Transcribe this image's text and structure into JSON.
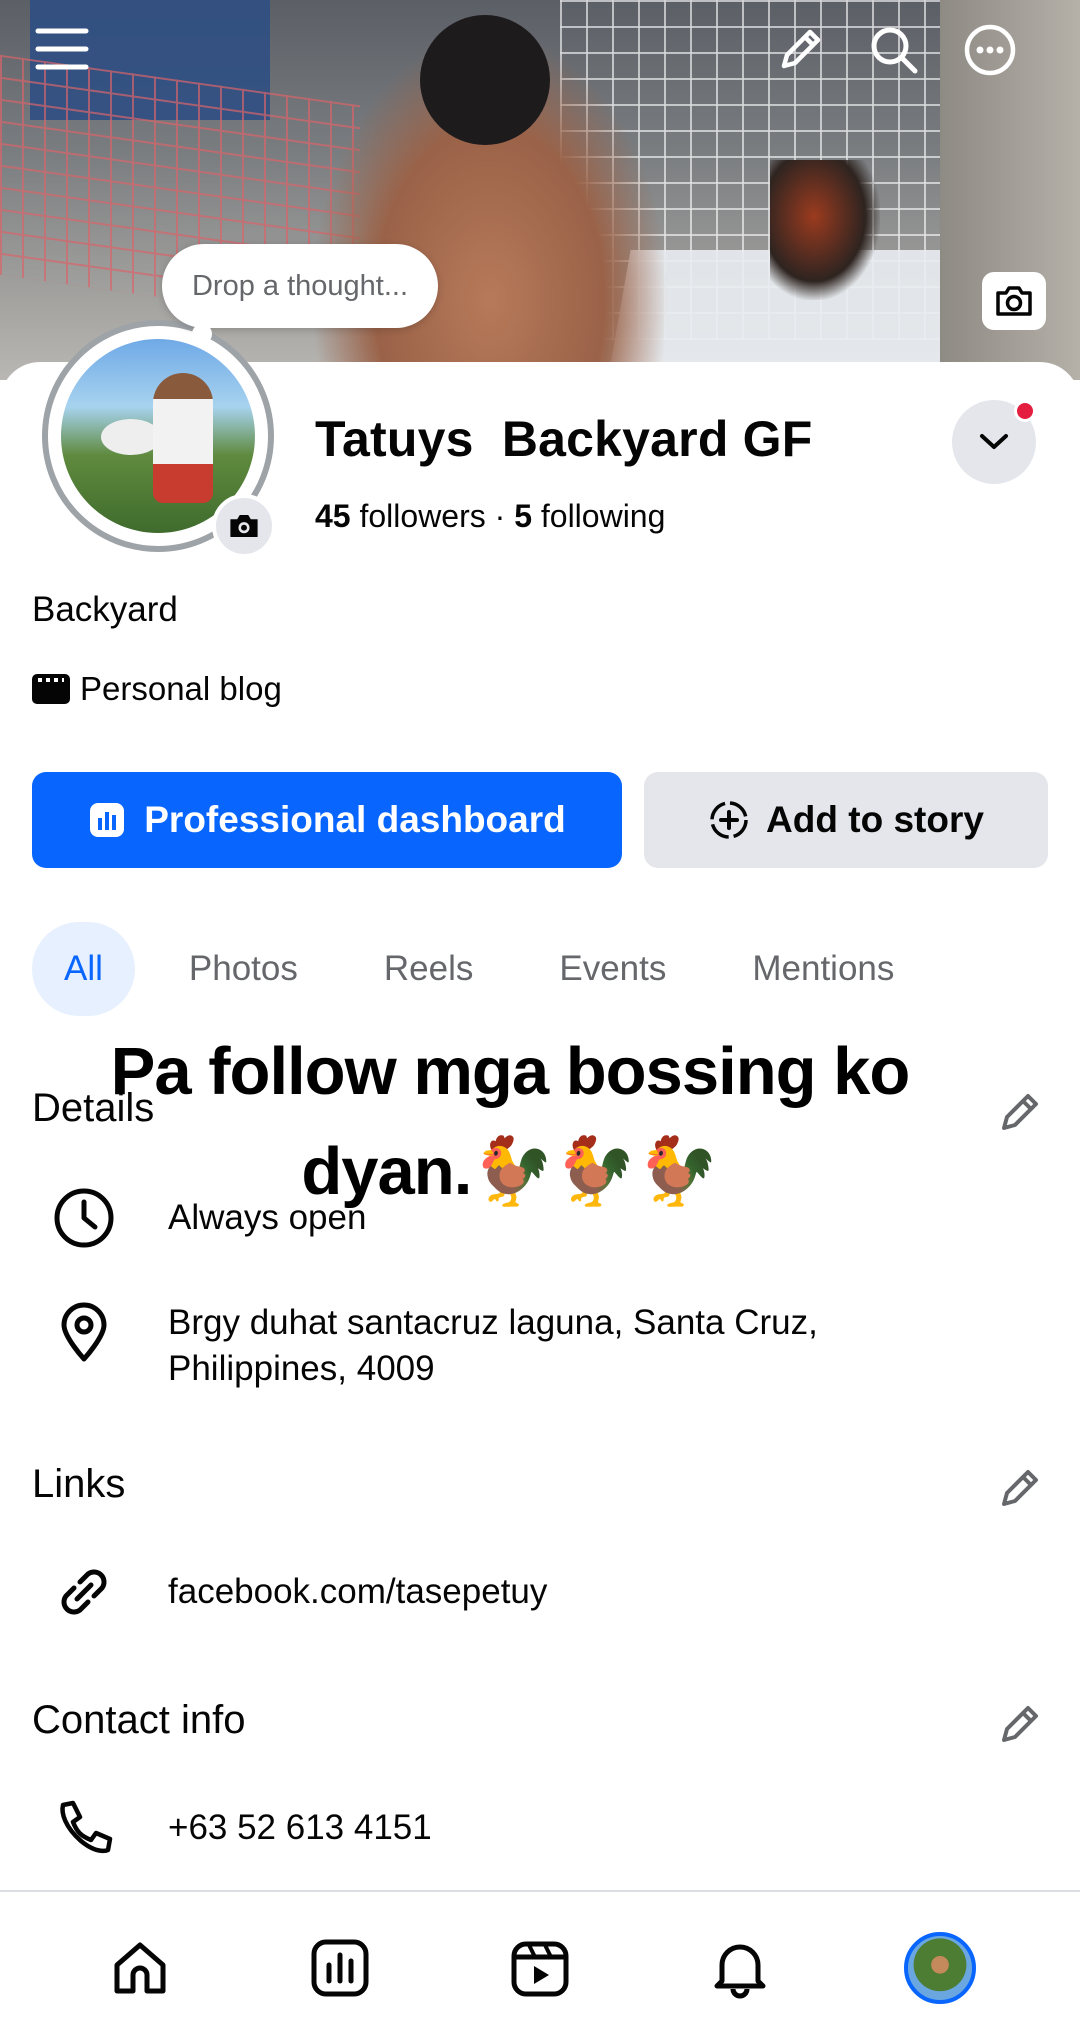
{
  "header": {
    "icons": [
      "menu-icon",
      "pencil-icon",
      "search-icon",
      "more-icon"
    ],
    "thought_placeholder": "Drop a thought..."
  },
  "profile": {
    "name": "Tatuys  Backyard GF",
    "followers_count": "45",
    "followers_label": "followers",
    "separator": "·",
    "following_count": "5",
    "following_label": "following",
    "category": "Backyard",
    "tag": "Personal blog"
  },
  "buttons": {
    "dashboard": "Professional dashboard",
    "story": "Add to story"
  },
  "tabs": [
    {
      "label": "All",
      "active": true
    },
    {
      "label": "Photos",
      "active": false
    },
    {
      "label": "Reels",
      "active": false
    },
    {
      "label": "Events",
      "active": false
    },
    {
      "label": "Mentions",
      "active": false
    }
  ],
  "overlay_caption": "Pa follow mga bossing ko dyan.🐓🐓🐓",
  "details": {
    "title": "Details",
    "hours": "Always open",
    "address": "Brgy duhat santacruz laguna, Santa Cruz, Philippines, 4009"
  },
  "links": {
    "title": "Links",
    "url": "facebook.com/tasepetuy"
  },
  "contact": {
    "title": "Contact info",
    "phone": "+63 52 613 4151"
  },
  "bottom_nav": [
    "home-icon",
    "dashboard-icon",
    "reels-icon",
    "bell-icon",
    "profile-avatar"
  ],
  "colors": {
    "accent": "#0866ff",
    "notification": "#e41e3f",
    "secondary_button": "#e4e6eb",
    "active_tab_bg": "#e7f0fe"
  }
}
